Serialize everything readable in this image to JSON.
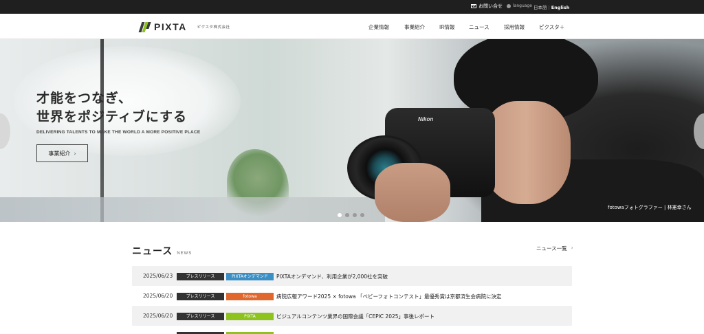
{
  "topbar": {
    "contact_label": "お問い合せ",
    "language_label": "language",
    "lang_ja": "日本語",
    "lang_sep": "|",
    "lang_en": "English"
  },
  "header": {
    "logo_word": "PIXTA",
    "logo_corp": "ピクスタ株式会社",
    "nav": [
      {
        "label": "企業情報"
      },
      {
        "label": "事業紹介"
      },
      {
        "label": "IR情報"
      },
      {
        "label": "ニュース"
      },
      {
        "label": "採用情報"
      },
      {
        "label": "ピクスタ＋"
      }
    ]
  },
  "hero": {
    "headline_line1": "才能をつなぎ、",
    "headline_line2": "世界をポジティブにする",
    "subheadline": "DELIVERING TALENTS TO MAKE THE WORLD A MORE POSITIVE PLACE",
    "cta_label": "事業紹介",
    "cta_chevron": "›",
    "camera_brand": "Nikon",
    "caption": "fotowaフォトグラファー | 林憲幸さん",
    "slide_count": 4,
    "active_slide": 1
  },
  "news": {
    "title": "ニュース",
    "title_en": "NEWS",
    "all_link": "ニュース一覧",
    "all_chevron": "›",
    "items": [
      {
        "date": "2025/06/23",
        "category": "プレスリリース",
        "service": "PIXTAオンデマンド",
        "service_color": "#3a8fc4",
        "title": "PIXTAオンデマンド、利用企業が2,000社を突破"
      },
      {
        "date": "2025/06/20",
        "category": "プレスリリース",
        "service": "fotowa",
        "service_color": "#e0672d",
        "title": "病院広報アワード2025 × fotowa 「ベビーフォトコンテスト」最優秀賞は京都済生会病院に決定"
      },
      {
        "date": "2025/06/20",
        "category": "プレスリリース",
        "service": "PIXTA",
        "service_color": "#8dc21f",
        "title": "ビジュアルコンテンツ業界の国際会議「CEPIC 2025」事後レポート"
      }
    ]
  },
  "colors": {
    "topbar_bg": "#1f1f1f",
    "brand_green": "#8dc21f",
    "category_tag": "#333333"
  }
}
